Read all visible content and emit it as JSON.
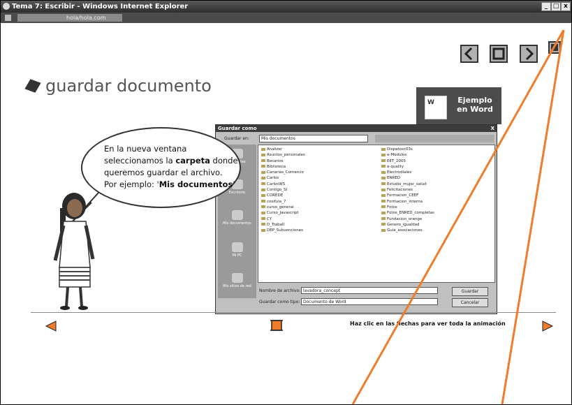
{
  "window": {
    "title": "Tema 7: Escribir - Windows Internet Explorer",
    "url": "hola/hola.com",
    "minimize_label": "_",
    "maximize_label": "□",
    "close_label": "x"
  },
  "nav_top": {
    "prev_icon": "chevron-left-icon",
    "stop_icon": "square-icon",
    "next_icon": "chevron-right-icon",
    "close_icon": "close-icon"
  },
  "lesson": {
    "heading": "guardar documento",
    "example_line1": "Ejemplo",
    "example_line2": "en Word"
  },
  "bubble": {
    "line1": "En  la nueva ventana",
    "line2_pre": "seleccionamos la ",
    "line2_bold": "carpeta",
    "line2_post": " donde",
    "line3": "queremos guardar el archivo.",
    "line4_pre": "Por ejemplo: '",
    "line4_bold": "Mis documentos",
    "line4_post": "'"
  },
  "dialog": {
    "title": "Guardar como",
    "close": "X",
    "save_in_label": "Guardar en:",
    "save_in_value": "Mis documentos",
    "places": [
      "Recientes",
      "Escritorio",
      "Mis documentos",
      "Mi PC",
      "Mis sitios de red"
    ],
    "files_left": [
      "Analizer",
      "Asuntos_personales",
      "Becarios",
      "Biblioteca",
      "Canarias_Comercio",
      "Carlos",
      "CarlosWS",
      "Contigo_SI",
      "COREDE",
      "cosifula_7",
      "curso_general",
      "Curso_Javascript",
      "CY",
      "D_Traball",
      "DEP_Subvenciones"
    ],
    "files_right": [
      "Dispatosc03s",
      "e-Modulos",
      "EET_2005",
      "e-quality",
      "Electrodiales",
      "ENRED",
      "Estudio_mujer_salud",
      "Felicitaciones",
      "Formacion_CEEF",
      "Formacion_interna",
      "Fotos",
      "Fotos_ENRED_completas",
      "Fundacion_orange",
      "Genero_igualdad",
      "Guia_asociaciones"
    ],
    "filename_label": "Nombre de archivo:",
    "filename_value": "lavadora_concept",
    "filetype_label": "Guardar como tipo:",
    "filetype_value": "Documento de Word",
    "save_button": "Guardar",
    "cancel_button": "Cancelar"
  },
  "bottom": {
    "hint": "Haz clic en las flechas para ver toda la animación"
  },
  "colors": {
    "accent": "#f07b2a",
    "nav_bg": "#b0b0b0",
    "titlebar": "#3a3a3a"
  }
}
